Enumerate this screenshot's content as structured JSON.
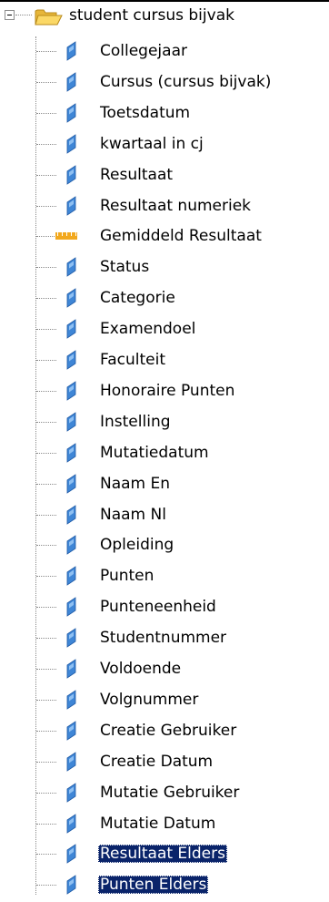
{
  "colors": {
    "selection_background": "#0a246a",
    "selection_text": "#ffffff",
    "folder_fill": "#f5c242",
    "field_icon_fill": "#3f86d6",
    "measure_icon_fill": "#f2a81d",
    "tree_lines": "#8a8a8a"
  },
  "tree": {
    "root": {
      "label": "student cursus bijvak",
      "icon": "open-folder-icon",
      "expander_icon": "collapse-minus-icon",
      "expanded": true
    },
    "items": [
      {
        "label": "Collegejaar",
        "icon": "field-icon",
        "selected": false
      },
      {
        "label": "Cursus (cursus bijvak)",
        "icon": "field-icon",
        "selected": false
      },
      {
        "label": "Toetsdatum",
        "icon": "field-icon",
        "selected": false
      },
      {
        "label": "kwartaal in cj",
        "icon": "field-icon",
        "selected": false
      },
      {
        "label": "Resultaat",
        "icon": "field-icon",
        "selected": false
      },
      {
        "label": "Resultaat numeriek",
        "icon": "field-icon",
        "selected": false
      },
      {
        "label": "Gemiddeld Resultaat",
        "icon": "measure-icon",
        "selected": false
      },
      {
        "label": "Status",
        "icon": "field-icon",
        "selected": false
      },
      {
        "label": "Categorie",
        "icon": "field-icon",
        "selected": false
      },
      {
        "label": "Examendoel",
        "icon": "field-icon",
        "selected": false
      },
      {
        "label": "Faculteit",
        "icon": "field-icon",
        "selected": false
      },
      {
        "label": "Honoraire Punten",
        "icon": "field-icon",
        "selected": false
      },
      {
        "label": "Instelling",
        "icon": "field-icon",
        "selected": false
      },
      {
        "label": "Mutatiedatum",
        "icon": "field-icon",
        "selected": false
      },
      {
        "label": "Naam En",
        "icon": "field-icon",
        "selected": false
      },
      {
        "label": "Naam Nl",
        "icon": "field-icon",
        "selected": false
      },
      {
        "label": "Opleiding",
        "icon": "field-icon",
        "selected": false
      },
      {
        "label": "Punten",
        "icon": "field-icon",
        "selected": false
      },
      {
        "label": "Punteneenheid",
        "icon": "field-icon",
        "selected": false
      },
      {
        "label": "Studentnummer",
        "icon": "field-icon",
        "selected": false
      },
      {
        "label": "Voldoende",
        "icon": "field-icon",
        "selected": false
      },
      {
        "label": "Volgnummer",
        "icon": "field-icon",
        "selected": false
      },
      {
        "label": "Creatie Gebruiker",
        "icon": "field-icon",
        "selected": false
      },
      {
        "label": "Creatie Datum",
        "icon": "field-icon",
        "selected": false
      },
      {
        "label": "Mutatie Gebruiker",
        "icon": "field-icon",
        "selected": false
      },
      {
        "label": "Mutatie Datum",
        "icon": "field-icon",
        "selected": false
      },
      {
        "label": "Resultaat Elders",
        "icon": "field-icon",
        "selected": true
      },
      {
        "label": "Punten Elders",
        "icon": "field-icon",
        "selected": true
      }
    ]
  }
}
